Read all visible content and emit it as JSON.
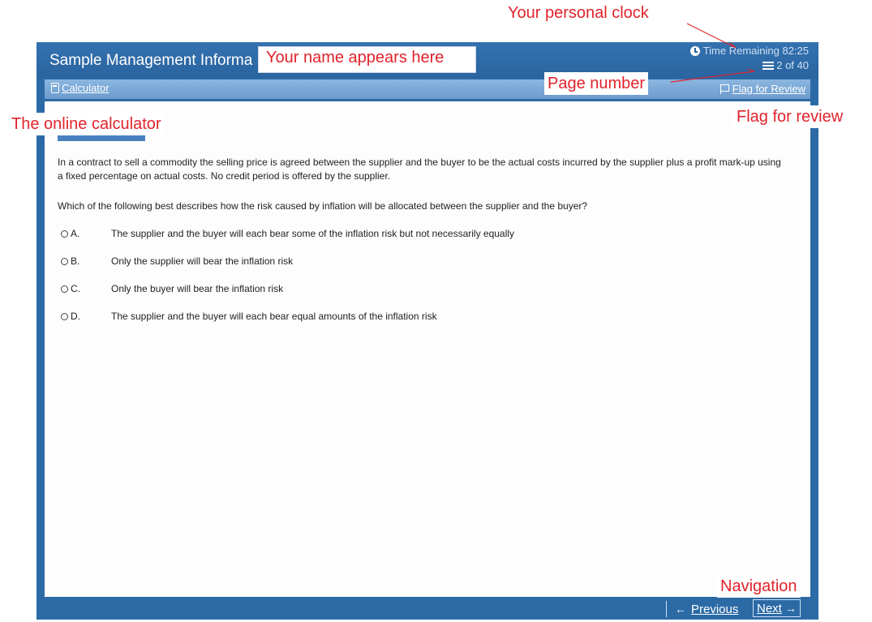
{
  "header": {
    "exam_title": "Sample Management Informa",
    "time_label": "Time Remaining 82:25",
    "page_label": "2 of 40"
  },
  "toolbar": {
    "calculator_label": "Calculator",
    "flag_label": "Flag for Review"
  },
  "question": {
    "stem": "In a contract to sell a commodity the selling price is agreed between the supplier and the buyer to be the actual costs incurred by the supplier plus a profit mark-up using a fixed percentage on actual costs. No credit period is offered by the supplier.",
    "prompt": "Which of the following best describes how the risk caused by inflation will be allocated between the supplier and the buyer?",
    "options": [
      {
        "letter": "A.",
        "text": "The supplier and the buyer will each bear some of the inflation risk but not necessarily equally"
      },
      {
        "letter": "B.",
        "text": "Only the supplier will bear the inflation risk"
      },
      {
        "letter": "C.",
        "text": "Only the buyer will bear the inflation risk"
      },
      {
        "letter": "D.",
        "text": "The supplier and the buyer will each bear equal amounts of the inflation risk"
      }
    ]
  },
  "nav": {
    "previous_label": "Previous",
    "next_label": "Next"
  },
  "annotations": {
    "personal_clock": "Your personal clock",
    "name_here": "Your name appears here",
    "page_number": "Page number",
    "flag_for_review": "Flag for review",
    "online_calculator": "The online calculator",
    "navigation": "Navigation"
  },
  "colors": {
    "frame_blue": "#2c6aa6",
    "toolbar_blue": "#6b9bcd",
    "annotation_red": "#e1232b"
  },
  "icons": [
    "clock-icon",
    "page-icon",
    "calculator-icon",
    "flag-icon",
    "arrow-left-icon",
    "arrow-right-icon"
  ]
}
